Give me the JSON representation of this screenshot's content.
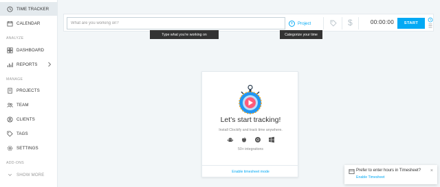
{
  "sidebar": {
    "items": [
      {
        "label": "TIME TRACKER",
        "icon": "clock-icon",
        "active": true
      },
      {
        "label": "CALENDAR",
        "icon": "calendar-icon"
      },
      {
        "label": "DASHBOARD",
        "icon": "dashboard-icon"
      },
      {
        "label": "REPORTS",
        "icon": "bar-chart-icon"
      },
      {
        "label": "PROJECTS",
        "icon": "document-icon"
      },
      {
        "label": "TEAM",
        "icon": "team-icon"
      },
      {
        "label": "CLIENTS",
        "icon": "client-icon"
      },
      {
        "label": "TAGS",
        "icon": "tag-icon"
      },
      {
        "label": "SETTINGS",
        "icon": "gear-icon"
      }
    ],
    "sections": {
      "analyze": "ANALYZE",
      "manage": "MANAGE",
      "addons": "ADD-ONS"
    },
    "show_more": "SHOW MORE"
  },
  "tracker": {
    "description_placeholder": "What are you working on?",
    "project_label": "Project",
    "timer": "00:00:00",
    "start_label": "START"
  },
  "tooltips": {
    "description": "Type what you're working on",
    "project": "Categorize your time"
  },
  "empty_state": {
    "title": "Let's start tracking!",
    "subtitle": "Install Clockify and track time anywhere.",
    "integrations": "50+ integrations",
    "timesheet_link": "Enable timesheet mode"
  },
  "notification": {
    "message": "Prefer to enter hours in Timesheet?",
    "link": "Enable Timesheet"
  },
  "colors": {
    "accent": "#03a9f4",
    "sidebar_active": "#e4eaee",
    "background": "#f2f6f8"
  }
}
